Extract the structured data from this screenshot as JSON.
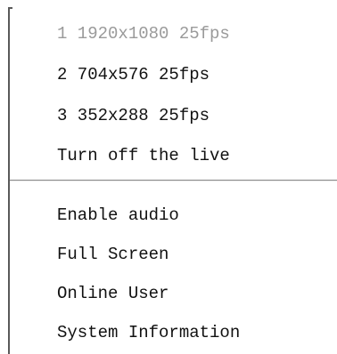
{
  "context_menu": {
    "stream_options": [
      {
        "label": "1 1920x1080 25fps",
        "enabled": false
      },
      {
        "label": "2 704x576 25fps",
        "enabled": true
      },
      {
        "label": "3 352x288 25fps",
        "enabled": true
      },
      {
        "label": "Turn off the live",
        "enabled": true
      }
    ],
    "actions": [
      {
        "label": "Enable audio"
      },
      {
        "label": "Full Screen"
      },
      {
        "label": "Online User"
      },
      {
        "label": "System Information"
      }
    ]
  }
}
